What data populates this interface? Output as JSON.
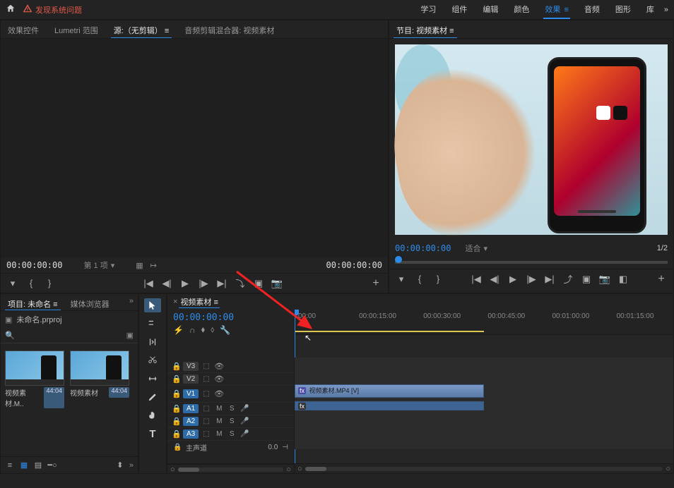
{
  "top": {
    "warning": "发现系统问题",
    "menu": [
      "学习",
      "组件",
      "编辑",
      "颜色",
      "效果",
      "音频",
      "图形",
      "库"
    ],
    "menu_active_idx": 4
  },
  "source_tabs": {
    "items": [
      "效果控件",
      "Lumetri 范围",
      "源:（无剪辑）",
      "音频剪辑混合器: 视频素材"
    ],
    "active_idx": 2
  },
  "program": {
    "title": "节目: 视频素材",
    "tc_left": "00:00:00:00",
    "fit": "适合",
    "zoom": "1/2"
  },
  "source": {
    "tc_left": "00:00:00:00",
    "select_label": "第 1 项",
    "tc_right": "00:00:00:00"
  },
  "project": {
    "tabs": [
      "项目: 未命名",
      "媒体浏览器"
    ],
    "active_idx": 0,
    "file": "未命名.prproj",
    "bins": [
      {
        "name": "视频素材.M..",
        "dur": "44:04"
      },
      {
        "name": "视频素材",
        "dur": "44:04"
      }
    ]
  },
  "timeline": {
    "title": "视频素材",
    "tc": "00:00:00:00",
    "ruler_ticks": [
      {
        "label": "c00:00",
        "pct": 0
      },
      {
        "label": "00:00:15:00",
        "pct": 17
      },
      {
        "label": "00:00:30:00",
        "pct": 34
      },
      {
        "label": "00:00:45:00",
        "pct": 51
      },
      {
        "label": "00:01:00:00",
        "pct": 68
      },
      {
        "label": "00:01:15:00",
        "pct": 85
      }
    ],
    "video_tracks": [
      {
        "name": "V3",
        "sel": false
      },
      {
        "name": "V2",
        "sel": false
      },
      {
        "name": "V1",
        "sel": true
      }
    ],
    "audio_tracks": [
      {
        "name": "A1",
        "sel": true
      },
      {
        "name": "A2",
        "sel": true
      },
      {
        "name": "A3",
        "sel": true
      }
    ],
    "master": "主声道",
    "master_val": "0.0",
    "clip_label": "视频素材.MP4 [V]",
    "clip_end_pct": 50,
    "in_out_pct": 50
  },
  "colors": {
    "accent": "#2d8ceb",
    "warning": "#e05a47",
    "ruler_bar": "#dbc94f"
  }
}
